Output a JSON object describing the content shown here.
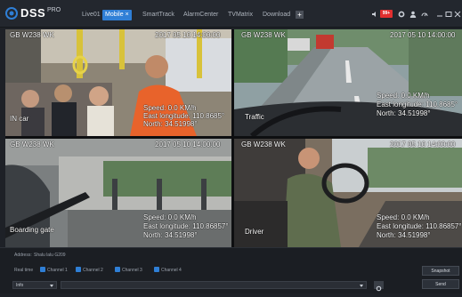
{
  "app": {
    "brand": "DSS",
    "edition": "PRO",
    "tabs": [
      {
        "label": "Live01",
        "active": false
      },
      {
        "label": "Mobile ×",
        "active": true
      },
      {
        "label": "SmartTrack",
        "active": false
      },
      {
        "label": "AlarmCenter",
        "active": false
      },
      {
        "label": "TVMatrix",
        "active": false
      },
      {
        "label": "Download",
        "active": false
      }
    ],
    "add_tab": "+",
    "alarm_badge": "99+",
    "icons": [
      "volume-icon",
      "alarm-icon",
      "gear-icon",
      "user-icon",
      "speed-icon",
      "minimize-icon",
      "maximize-icon",
      "close-icon"
    ],
    "accent_color": "#2f7fd6",
    "alarm_color": "#e22f2f"
  },
  "videos": [
    {
      "plate": "GB W238 WK",
      "timestamp": "2017 05 10 14:00:00",
      "speed": "Speed: 0.0 KM/h",
      "longitude": "East longitude: 110.8685°",
      "latitude": "North: 34.51998°",
      "channel": "IN car"
    },
    {
      "plate": "GB W238 WK",
      "timestamp": "2017 05 10 14:00:00",
      "speed": "Speed: 0.0 KM/h",
      "longitude": "East longitude: 110.8685°",
      "latitude": "North: 34.51998°",
      "channel": "Traffic"
    },
    {
      "plate": "GB W238 WK",
      "timestamp": "2017 05 10 14:00:00",
      "speed": "Speed: 0.0 KM/h",
      "longitude": "East longitude: 110.86857°",
      "latitude": "North: 34.51998°",
      "channel": "Boarding gate"
    },
    {
      "plate": "GB W238 WK",
      "timestamp": "2017 05 10 14:00:00",
      "speed": "Speed: 0.0 KM/h",
      "longitude": "East longitude: 110.86857°",
      "latitude": "North: 34.51998°",
      "channel": "Driver"
    }
  ],
  "panel": {
    "address_label": "Address:",
    "address_value": "Shalu lalu G209",
    "realtime_label": "Real time",
    "channels": [
      "Channel 1",
      "Channel 2",
      "Channel 3",
      "Channel 4"
    ],
    "level_select": "Info",
    "snapshot_button": "Snapshot",
    "send_button": "Send"
  }
}
